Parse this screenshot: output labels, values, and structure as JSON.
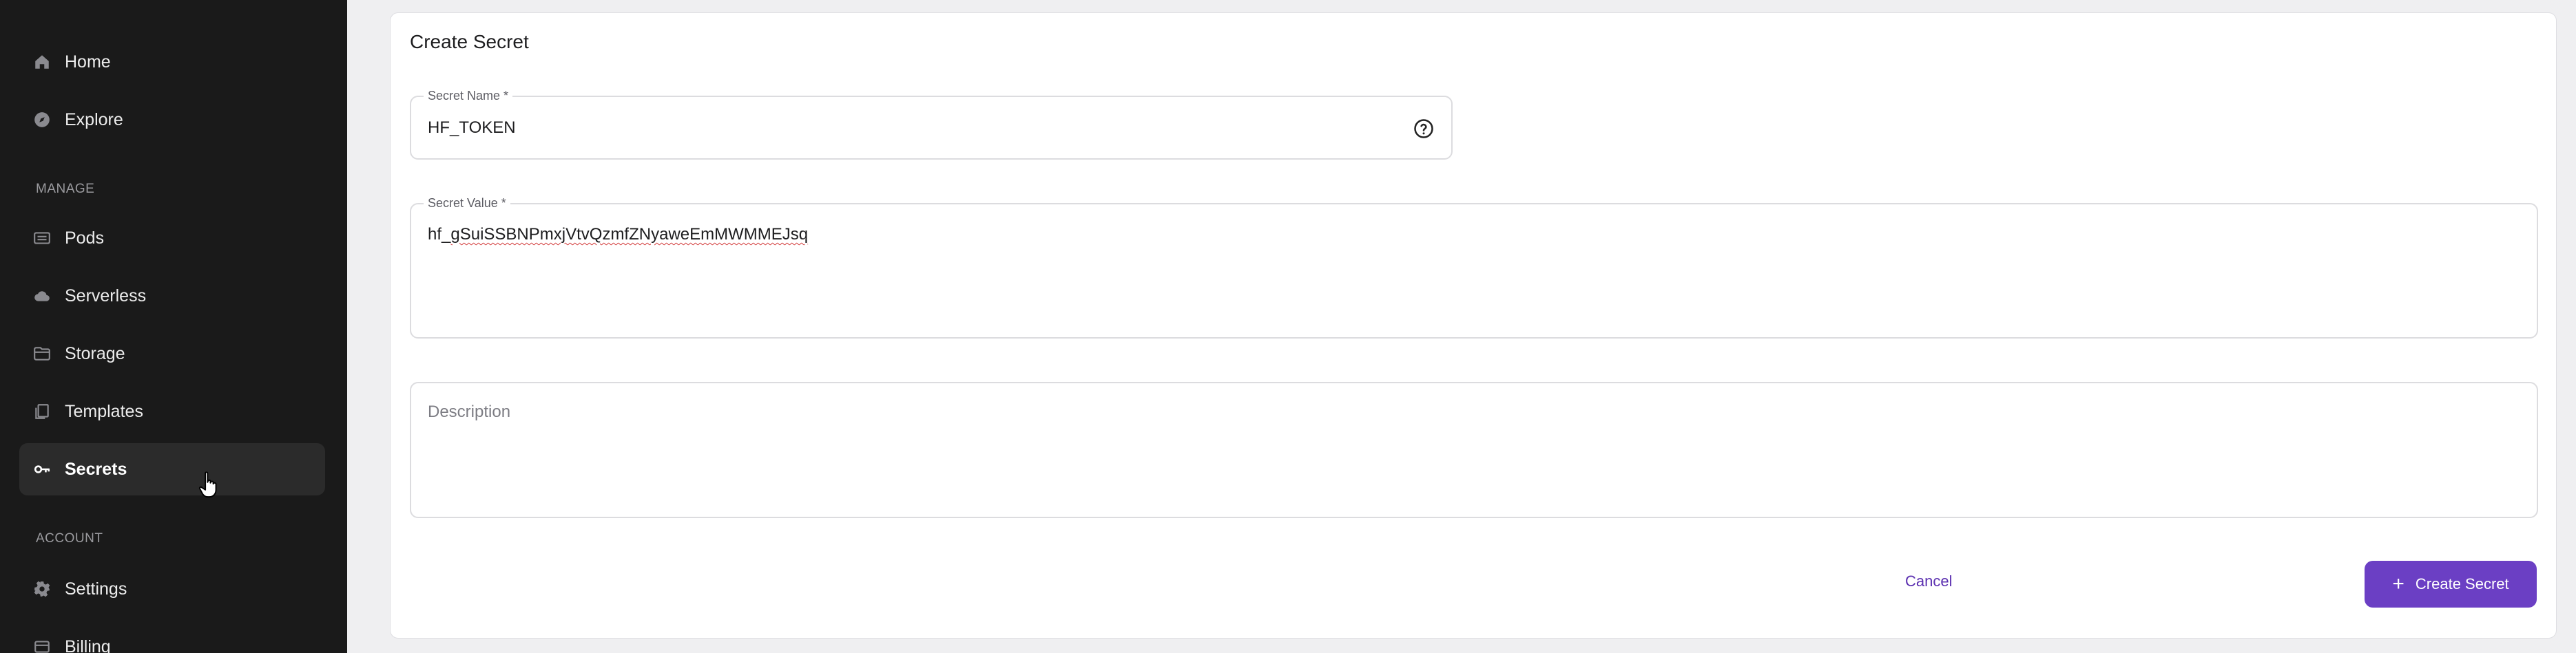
{
  "sidebar": {
    "items": [
      {
        "label": "Home",
        "icon": "home-icon"
      },
      {
        "label": "Explore",
        "icon": "compass-icon"
      }
    ],
    "manage_title": "MANAGE",
    "manage_items": [
      {
        "label": "Pods",
        "icon": "pods-icon"
      },
      {
        "label": "Serverless",
        "icon": "cloud-icon"
      },
      {
        "label": "Storage",
        "icon": "folder-icon"
      },
      {
        "label": "Templates",
        "icon": "templates-icon"
      },
      {
        "label": "Secrets",
        "icon": "key-icon",
        "active": true
      }
    ],
    "account_title": "ACCOUNT",
    "account_items": [
      {
        "label": "Settings",
        "icon": "gear-icon"
      },
      {
        "label": "Billing",
        "icon": "billing-icon"
      }
    ]
  },
  "form": {
    "title": "Create Secret",
    "secret_name": {
      "label": "Secret Name *",
      "value": "HF_TOKEN"
    },
    "secret_value": {
      "label": "Secret Value *",
      "prefix": "hf_",
      "rest": "gSuiSSBNPmxjVtvQzmfZNyaweEmMWMMEJsq"
    },
    "description": {
      "placeholder": "Description",
      "value": ""
    },
    "cancel_label": "Cancel",
    "create_label": "Create Secret"
  },
  "colors": {
    "sidebar_bg": "#1a1a1a",
    "accent": "#6b3fc4",
    "page_bg": "#efeff1"
  }
}
